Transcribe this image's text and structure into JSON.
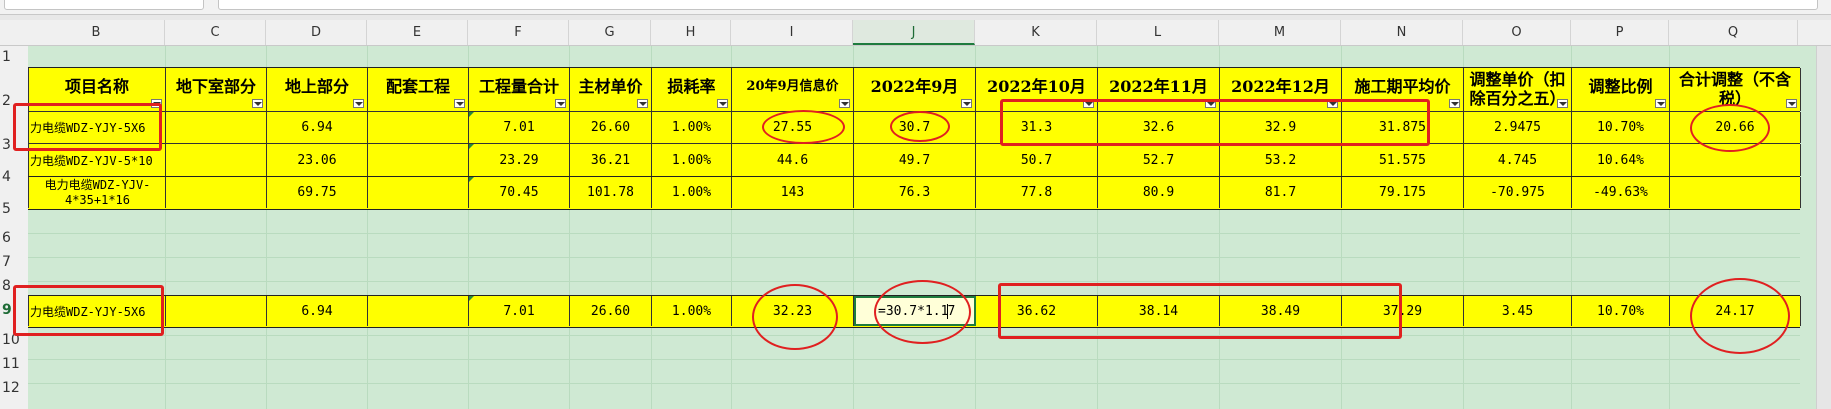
{
  "toolbar": {
    "name_box_text": "",
    "formula_text": ""
  },
  "columns": [
    "B",
    "C",
    "D",
    "E",
    "F",
    "G",
    "H",
    "I",
    "J",
    "K",
    "L",
    "M",
    "N",
    "O",
    "P",
    "Q"
  ],
  "active_column": "J",
  "rows": [
    "1",
    "2",
    "3",
    "4",
    "5",
    "6",
    "7",
    "8",
    "9",
    "10",
    "11",
    "12"
  ],
  "active_row": "9",
  "headers": {
    "B": "项目名称",
    "C": "地下室部分",
    "D": "地上部分",
    "E": "配套工程",
    "F": "工程量合计",
    "G": "主材单价",
    "H": "损耗率",
    "I": "20年9月信息价",
    "J": "2022年9月",
    "K": "2022年10月",
    "L": "2022年11月",
    "M": "2022年12月",
    "N": "施工期平均价",
    "O": "调整单价（扣除百分之五）",
    "P": "调整比例",
    "Q": "合计调整（不含税）"
  },
  "data_rows": [
    {
      "row": "3",
      "B": "力电缆WDZ-YJY-5X6",
      "C": "",
      "D": "6.94",
      "E": "",
      "F": "7.01",
      "G": "26.60",
      "H": "1.00%",
      "I": "27.55",
      "J": "30.7",
      "K": "31.3",
      "L": "32.6",
      "M": "32.9",
      "N": "31.875",
      "O": "2.9475",
      "P": "10.70%",
      "Q": "20.66"
    },
    {
      "row": "4",
      "B": "力电缆WDZ-YJV-5*10",
      "C": "",
      "D": "23.06",
      "E": "",
      "F": "23.29",
      "G": "36.21",
      "H": "1.00%",
      "I": "44.6",
      "J": "49.7",
      "K": "50.7",
      "L": "52.7",
      "M": "53.2",
      "N": "51.575",
      "O": "4.745",
      "P": "10.64%",
      "Q": ""
    },
    {
      "row": "5",
      "B": "电力电缆WDZ-YJV-",
      "B2": "4*35+1*16",
      "C": "",
      "D": "69.75",
      "E": "",
      "F": "70.45",
      "G": "101.78",
      "H": "1.00%",
      "I": "143",
      "J": "76.3",
      "K": "77.8",
      "L": "80.9",
      "M": "81.7",
      "N": "79.175",
      "O": "-70.975",
      "P": "-49.63%",
      "Q": ""
    },
    {
      "row": "9",
      "B": "力电缆WDZ-YJY-5X6",
      "C": "",
      "D": "6.94",
      "E": "",
      "F": "7.01",
      "G": "26.60",
      "H": "1.00%",
      "I": "32.23",
      "J_before": "=30.7*1.1",
      "J_after": "7",
      "K": "36.62",
      "L": "38.14",
      "M": "38.49",
      "N": "37.29",
      "O": "3.45",
      "P": "10.70%",
      "Q": "24.17"
    }
  ],
  "colors": {
    "highlight": "#ffff00",
    "sheet_bg": "#cfe9d3",
    "annotation": "#e02020",
    "selection": "#1e7b3e"
  }
}
